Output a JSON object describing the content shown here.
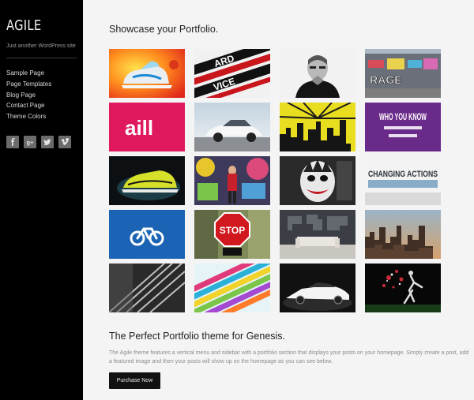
{
  "sidebar": {
    "site_title": "AGILE",
    "site_description": "Just another WordPress site",
    "nav": [
      {
        "label": "Sample Page"
      },
      {
        "label": "Page Templates"
      },
      {
        "label": "Blog Page"
      },
      {
        "label": "Contact Page"
      },
      {
        "label": "Theme Colors"
      }
    ],
    "social": [
      {
        "icon": "facebook-icon",
        "glyph": "f"
      },
      {
        "icon": "google-plus-icon",
        "glyph": "g+"
      },
      {
        "icon": "twitter-icon",
        "glyph": "t"
      },
      {
        "icon": "vimeo-icon",
        "glyph": "v"
      }
    ]
  },
  "main": {
    "portfolio_title": "Showcase your Portfolio.",
    "portfolio_tiles": [
      {
        "name": "sneaker-splash"
      },
      {
        "name": "hardcore-typography"
      },
      {
        "name": "steve-jobs-portrait"
      },
      {
        "name": "graffiti-wall"
      },
      {
        "name": "aill-logo",
        "text": "aill"
      },
      {
        "name": "white-sports-car"
      },
      {
        "name": "city-silhouette"
      },
      {
        "name": "who-you-know-poster",
        "text": "WHO YOU KNOW"
      },
      {
        "name": "running-shoe"
      },
      {
        "name": "graffiti-girl"
      },
      {
        "name": "joker-mural"
      },
      {
        "name": "changing-actions",
        "text": "CHANGING ACTIONS"
      },
      {
        "name": "bike-logo"
      },
      {
        "name": "stop-sign",
        "text": "STOP"
      },
      {
        "name": "world-map-sofa"
      },
      {
        "name": "city-aerial"
      },
      {
        "name": "apple-store-stairs"
      },
      {
        "name": "colorful-blocks"
      },
      {
        "name": "white-lamborghini"
      },
      {
        "name": "dancer-explosion"
      }
    ],
    "promo": {
      "title": "The Perfect Portfolio theme for Genesis.",
      "text": "The Agile theme features a vertical menu and sidebar with a portfolio section that displays your posts on your homepage. Simply create a post, add a featured image and then your posts will show up on the homepage as you can see below.",
      "button_label": "Purchase Now"
    }
  }
}
